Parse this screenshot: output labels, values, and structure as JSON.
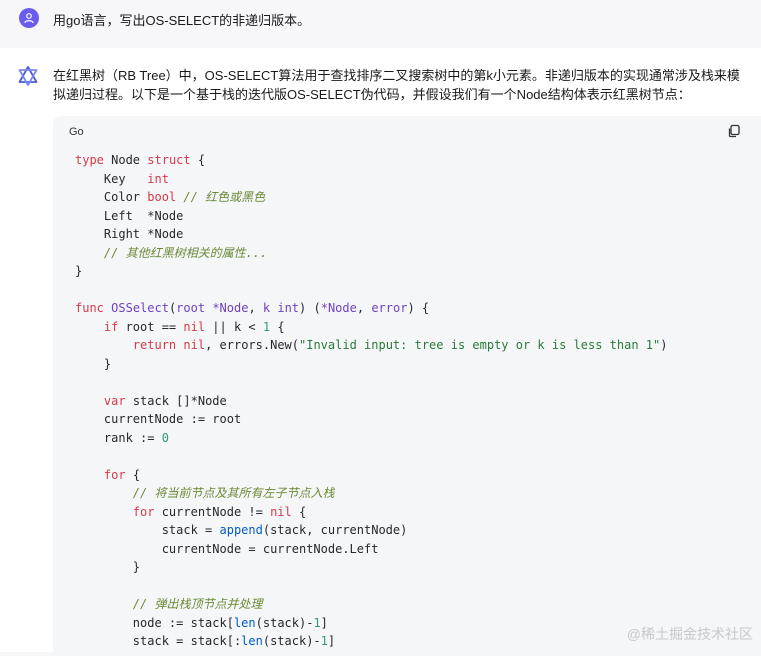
{
  "user_message": {
    "text": "用go语言，写出OS-SELECT的非递归版本。"
  },
  "assistant_message": {
    "intro": "在红黑树（RB Tree）中，OS-SELECT算法用于查找排序二叉搜索树中的第k小元素。非递归版本的实现通常涉及栈来模拟递归过程。以下是一个基于栈的迭代版OS-SELECT伪代码，并假设我们有一个Node结构体表示红黑树节点：",
    "code_block": {
      "language": "Go",
      "copy_icon": "copy-icon",
      "lines": [
        [
          [
            "kw",
            "type"
          ],
          [
            "p",
            " Node "
          ],
          [
            "kw",
            "struct"
          ],
          [
            "p",
            " {"
          ]
        ],
        [
          [
            "p",
            "    Key   "
          ],
          [
            "ty",
            "int"
          ]
        ],
        [
          [
            "p",
            "    Color "
          ],
          [
            "ty",
            "bool"
          ],
          [
            "p",
            " "
          ],
          [
            "cm",
            "// 红色或黑色"
          ]
        ],
        [
          [
            "p",
            "    Left  *Node"
          ]
        ],
        [
          [
            "p",
            "    Right *Node"
          ]
        ],
        [
          [
            "p",
            "    "
          ],
          [
            "cm",
            "// 其他红黑树相关的属性..."
          ]
        ],
        [
          [
            "p",
            "}"
          ]
        ],
        [
          [
            "p",
            ""
          ]
        ],
        [
          [
            "kw",
            "func"
          ],
          [
            "p",
            " "
          ],
          [
            "fn",
            "OSSelect"
          ],
          [
            "p",
            "("
          ],
          [
            "fn",
            "root"
          ],
          [
            "p",
            " "
          ],
          [
            "fn",
            "*Node"
          ],
          [
            "p",
            ", "
          ],
          [
            "fn",
            "k"
          ],
          [
            "p",
            " "
          ],
          [
            "fn",
            "int"
          ],
          [
            "p",
            ") ("
          ],
          [
            "fn",
            "*Node"
          ],
          [
            "p",
            ", "
          ],
          [
            "fn",
            "error"
          ],
          [
            "p",
            ") {"
          ]
        ],
        [
          [
            "p",
            "    "
          ],
          [
            "kw",
            "if"
          ],
          [
            "p",
            " root == "
          ],
          [
            "kw",
            "nil"
          ],
          [
            "p",
            " || k < "
          ],
          [
            "num",
            "1"
          ],
          [
            "p",
            " {"
          ]
        ],
        [
          [
            "p",
            "        "
          ],
          [
            "kw",
            "return"
          ],
          [
            "p",
            " "
          ],
          [
            "kw",
            "nil"
          ],
          [
            "p",
            ", errors.New("
          ],
          [
            "str",
            "\"Invalid input: tree is empty or k is less than 1\""
          ],
          [
            "p",
            ")"
          ]
        ],
        [
          [
            "p",
            "    }"
          ]
        ],
        [
          [
            "p",
            ""
          ]
        ],
        [
          [
            "p",
            "    "
          ],
          [
            "kw",
            "var"
          ],
          [
            "p",
            " stack []*Node"
          ]
        ],
        [
          [
            "p",
            "    currentNode := root"
          ]
        ],
        [
          [
            "p",
            "    rank := "
          ],
          [
            "num",
            "0"
          ]
        ],
        [
          [
            "p",
            ""
          ]
        ],
        [
          [
            "p",
            "    "
          ],
          [
            "kw",
            "for"
          ],
          [
            "p",
            " {"
          ]
        ],
        [
          [
            "p",
            "        "
          ],
          [
            "cm",
            "// 将当前节点及其所有左子节点入栈"
          ]
        ],
        [
          [
            "p",
            "        "
          ],
          [
            "kw",
            "for"
          ],
          [
            "p",
            " currentNode != "
          ],
          [
            "kw",
            "nil"
          ],
          [
            "p",
            " {"
          ]
        ],
        [
          [
            "p",
            "            stack = "
          ],
          [
            "bi",
            "append"
          ],
          [
            "p",
            "(stack, currentNode)"
          ]
        ],
        [
          [
            "p",
            "            currentNode = currentNode.Left"
          ]
        ],
        [
          [
            "p",
            "        }"
          ]
        ],
        [
          [
            "p",
            ""
          ]
        ],
        [
          [
            "p",
            "        "
          ],
          [
            "cm",
            "// 弹出栈顶节点并处理"
          ]
        ],
        [
          [
            "p",
            "        node := stack["
          ],
          [
            "bi",
            "len"
          ],
          [
            "p",
            "(stack)-"
          ],
          [
            "num",
            "1"
          ],
          [
            "p",
            "]"
          ]
        ],
        [
          [
            "p",
            "        stack = stack[:"
          ],
          [
            "bi",
            "len"
          ],
          [
            "p",
            "(stack)-"
          ],
          [
            "num",
            "1"
          ],
          [
            "p",
            "]"
          ]
        ]
      ]
    }
  },
  "watermark": "@稀土掘金技术社区",
  "colors": {
    "user_avatar": "#6b5cf0",
    "code_bg": "#f5f6f8",
    "page_bg": "#f7f7fa"
  }
}
